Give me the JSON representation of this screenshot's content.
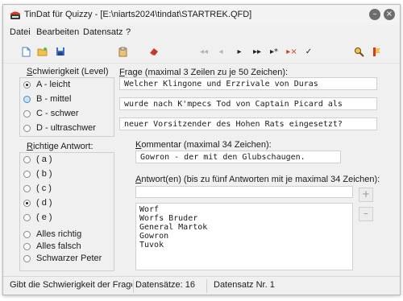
{
  "window": {
    "title": "TinDat für Quizzy - [E:\\niarts2024\\tindat\\STARTREK.QFD]",
    "minimize_glyph": "–",
    "close_glyph": "×"
  },
  "menu": [
    {
      "label": "Datei"
    },
    {
      "label": "Bearbeiten"
    },
    {
      "label": "Datensatz"
    },
    {
      "label": "?"
    }
  ],
  "toolbar": {
    "icons": [
      "new-file-icon",
      "open-folder-icon",
      "save-disk-icon",
      "clipboard-icon",
      "eraser-icon",
      "first-record-icon",
      "previous-record-icon",
      "next-record-icon",
      "last-record-icon",
      "append-record-icon",
      "delete-record-icon",
      "confirm-icon",
      "search-icon",
      "bookmark-icon"
    ]
  },
  "difficulty": {
    "title_pre": "",
    "title_ul": "S",
    "title_post": "chwierigkeit (Level)",
    "options": [
      {
        "label": "A  -  leicht",
        "selected": true
      },
      {
        "label": "B  -  mittel",
        "selected": false
      },
      {
        "label": "C  -  schwer",
        "selected": false
      },
      {
        "label": "D  -  ultraschwer",
        "selected": false
      }
    ]
  },
  "correct_answer": {
    "title_ul": "R",
    "title_post": "ichtige Antwort:",
    "options": [
      {
        "label": "( a )",
        "selected": false
      },
      {
        "label": "( b )",
        "selected": false
      },
      {
        "label": "( c )",
        "selected": false
      },
      {
        "label": "( d )",
        "selected": true
      },
      {
        "label": "( e )",
        "selected": false
      },
      {
        "label": "Alles richtig",
        "selected": false
      },
      {
        "label": "Alles falsch",
        "selected": false
      },
      {
        "label": "Schwarzer Peter",
        "selected": false
      }
    ]
  },
  "question": {
    "label_ul": "F",
    "label_post": "rage (maximal 3 Zeilen zu je 50 Zeichen):",
    "lines": [
      "Welcher Klingone und Erzrivale von Duras",
      "wurde nach K'mpecs Tod von Captain Picard als",
      "neuer Vorsitzender des Hohen Rats eingesetzt?"
    ]
  },
  "comment": {
    "label_ul": "K",
    "label_post": "ommentar (maximal 34 Zeichen):",
    "value": "Gowron - der mit den Glubschaugen."
  },
  "answers": {
    "label_ul": "A",
    "label_post": "ntwort(en) (bis zu fünf Antworten mit je maximal 34 Zeichen):",
    "input_value": "",
    "add_glyph": "+",
    "remove_glyph": "–",
    "items": [
      "Worf",
      "Worfs Bruder",
      "General Martok",
      "Gowron",
      "Tuvok"
    ]
  },
  "status": {
    "hint": "Gibt die Schwierigkeit der Frage an",
    "count": "Datensätze: 16",
    "current": "Datensatz Nr. 1"
  }
}
